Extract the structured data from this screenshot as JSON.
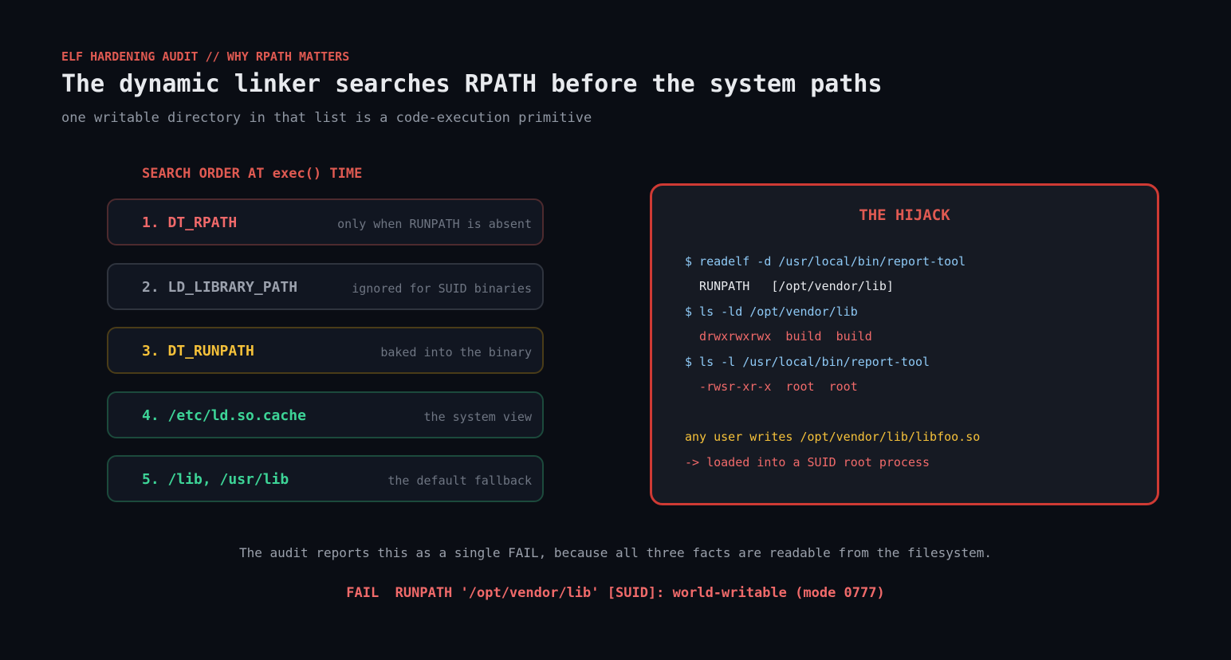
{
  "header": {
    "kicker": "ELF HARDENING AUDIT // WHY RPATH MATTERS",
    "title": "The dynamic linker searches RPATH before the system paths",
    "subtitle": "one writable directory in that list is a code-execution primitive"
  },
  "search_order": {
    "label": "SEARCH ORDER AT exec() TIME",
    "steps": [
      {
        "label": "1. DT_RPATH",
        "note": "only when RUNPATH is absent",
        "color": "#f0696a",
        "border": "#4d2a2e"
      },
      {
        "label": "2. LD_LIBRARY_PATH",
        "note": "ignored for SUID binaries",
        "color": "#9ba1ad",
        "border": "#2f343e"
      },
      {
        "label": "3. DT_RUNPATH",
        "note": "baked into the binary",
        "color": "#f5c13a",
        "border": "#4a3c18"
      },
      {
        "label": "4. /etc/ld.so.cache",
        "note": "the system view",
        "color": "#3dd497",
        "border": "#1c4a3c"
      },
      {
        "label": "5. /lib, /usr/lib",
        "note": "the default fallback",
        "color": "#3dd497",
        "border": "#1c4a3c"
      }
    ]
  },
  "hijack": {
    "title": "THE HIJACK",
    "lines": [
      {
        "text": "$ readelf -d /usr/local/bin/report-tool",
        "color": "#8ec9f5"
      },
      {
        "text": "  RUNPATH   [/opt/vendor/lib]",
        "color": "#e8eaee"
      },
      {
        "text": "$ ls -ld /opt/vendor/lib",
        "color": "#8ec9f5"
      },
      {
        "text": "  drwxrwxrwx  build  build",
        "color": "#f06a6a"
      },
      {
        "text": "$ ls -l /usr/local/bin/report-tool",
        "color": "#8ec9f5"
      },
      {
        "text": "  -rwsr-xr-x  root  root",
        "color": "#f06a6a"
      },
      {
        "text": "any user writes /opt/vendor/lib/libfoo.so",
        "color": "#f5c13a"
      },
      {
        "text": "-> loaded into a SUID root process",
        "color": "#f06a6a"
      }
    ]
  },
  "footer": {
    "note": "The audit reports this as a single FAIL, because all three facts are readable from the filesystem.",
    "fail": "FAIL  RUNPATH '/opt/vendor/lib' [SUID]: world-writable (mode 0777)"
  },
  "colors": {
    "background": "#0a0d14",
    "accent_red": "#e05a52",
    "hijack_border": "#cf3a34"
  }
}
